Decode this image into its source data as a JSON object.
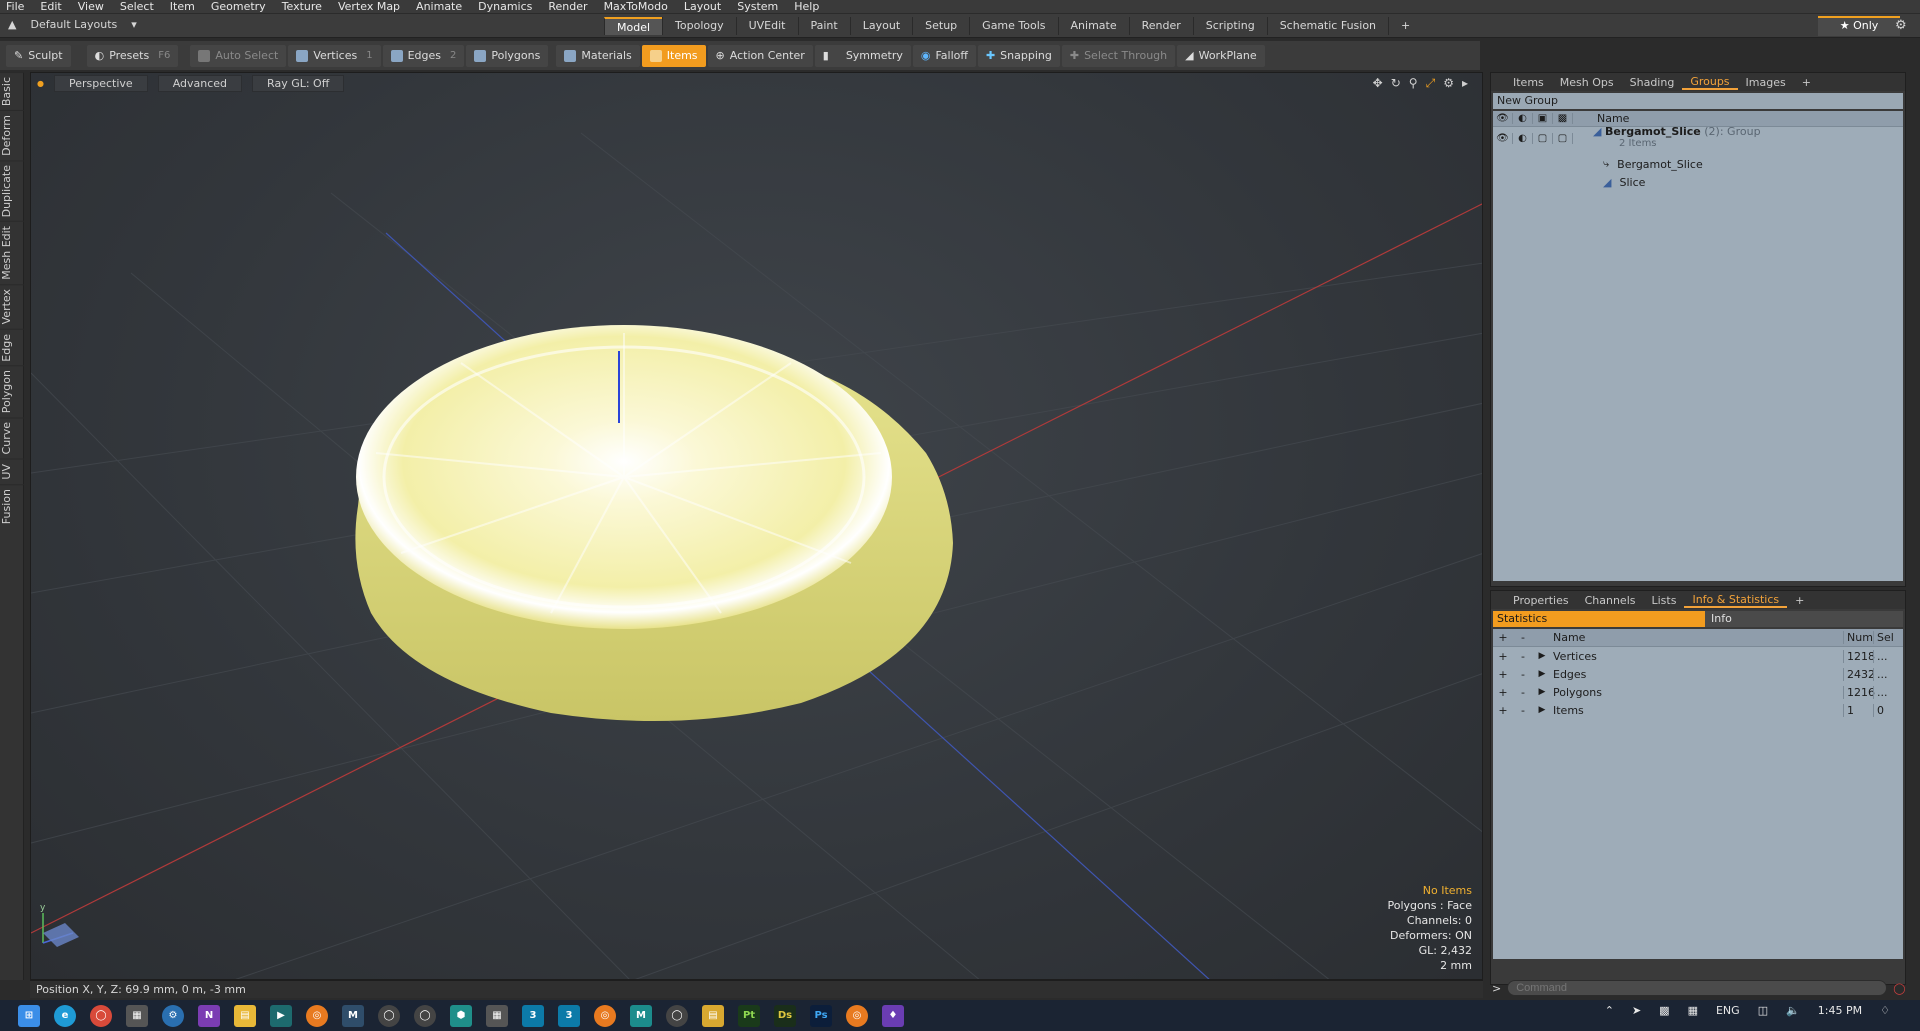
{
  "menu": [
    "File",
    "Edit",
    "View",
    "Select",
    "Item",
    "Geometry",
    "Texture",
    "Vertex Map",
    "Animate",
    "Dynamics",
    "Render",
    "MaxToModo",
    "Layout",
    "System",
    "Help"
  ],
  "layout_selector": "Default Layouts",
  "mode_tabs": [
    "Model",
    "Topology",
    "UVEdit",
    "Paint",
    "Layout",
    "Setup",
    "Game Tools",
    "Animate",
    "Render",
    "Scripting",
    "Schematic Fusion"
  ],
  "active_mode": "Model",
  "only_label": "Only",
  "toolbar": {
    "sculpt": "Sculpt",
    "presets": "Presets",
    "presets_key": "F6",
    "auto_select": "Auto Select",
    "vertices": "Vertices",
    "vertices_num": "1",
    "edges": "Edges",
    "edges_num": "2",
    "polygons": "Polygons",
    "materials": "Materials",
    "items": "Items",
    "action_center": "Action Center",
    "symmetry": "Symmetry",
    "falloff": "Falloff",
    "snapping": "Snapping",
    "select_through": "Select Through",
    "workplane": "WorkPlane"
  },
  "left_tabs": [
    "Basic",
    "Deform",
    "Duplicate",
    "Mesh Edit",
    "Vertex",
    "Edge",
    "Polygon",
    "Curve",
    "UV",
    "Fusion"
  ],
  "viewport": {
    "view_mode": "Perspective",
    "shading": "Advanced",
    "raygl": "Ray GL: Off",
    "stats": {
      "no_items": "No Items",
      "polygons": "Polygons : Face",
      "channels": "Channels: 0",
      "deformers": "Deformers: ON",
      "gl": "GL: 2,432",
      "grid": "2 mm"
    }
  },
  "status": {
    "position": "Position X, Y, Z:  69.9 mm, 0 m, -3 mm"
  },
  "top_panel": {
    "tabs": [
      "Items",
      "Mesh Ops",
      "Shading",
      "Groups",
      "Images"
    ],
    "active_tab": "Groups",
    "new_group": "New Group",
    "name_header": "Name",
    "group": {
      "name": "Bergamot_Slice",
      "count_label": "(2)",
      "type_label": ": Group",
      "items_label": "2 Items",
      "children": [
        "Bergamot_Slice",
        "Slice"
      ]
    }
  },
  "bottom_panel": {
    "tabs": [
      "Properties",
      "Channels",
      "Lists",
      "Info & Statistics"
    ],
    "active_tab": "Info & Statistics",
    "stat_tab": "Statistics",
    "info_tab": "Info",
    "headers": {
      "name": "Name",
      "num": "Num",
      "sel": "Sel"
    },
    "rows": [
      {
        "name": "Vertices",
        "num": "1218",
        "sel": "..."
      },
      {
        "name": "Edges",
        "num": "2432",
        "sel": "..."
      },
      {
        "name": "Polygons",
        "num": "1216",
        "sel": "..."
      },
      {
        "name": "Items",
        "num": "1",
        "sel": "0"
      }
    ]
  },
  "command_placeholder": "Command",
  "taskbar": {
    "lang": "ENG",
    "time": "1:45 PM"
  },
  "colors": {
    "accent": "#f29c1f",
    "panel_blue": "#9eacb8"
  }
}
